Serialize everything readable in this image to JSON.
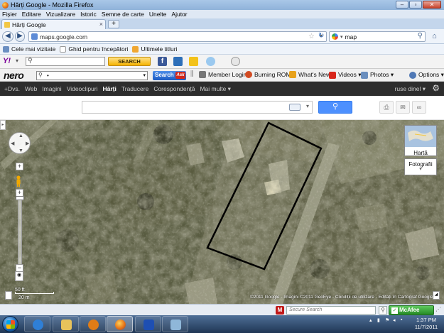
{
  "window": {
    "title": "Hărți Google - Mozilla Firefox"
  },
  "menu": [
    "Fișier",
    "Editare",
    "Vizualizare",
    "Istoric",
    "Semne de carte",
    "Unelte",
    "Ajutor"
  ],
  "tab": {
    "label": "Hărți Google",
    "close": "×",
    "new_tab": "+"
  },
  "nav": {
    "url": "maps.google.com",
    "search_value": "map",
    "search_engine": "google"
  },
  "bookmarks": [
    {
      "label": "Cele mai vizitate",
      "color": "#6b8fc2"
    },
    {
      "label": "Ghid pentru începători",
      "color": "#ffffff"
    },
    {
      "label": "Ultimele titluri",
      "color": "#f0a732"
    }
  ],
  "yahoo": {
    "logo": "Y!",
    "search_button": "SEARCH"
  },
  "nero": {
    "logo": "nero",
    "search_value": "•",
    "search_button": "Search",
    "ask_label": "Ask",
    "items": [
      {
        "label": "Member Login",
        "icon": "key-icon",
        "color": "#777777"
      },
      {
        "label": "Burning ROM",
        "icon": "disc-icon",
        "color": "#d24b22"
      },
      {
        "label": "What's New",
        "icon": "star-icon",
        "color": "#e8a21b"
      },
      {
        "label": "Videos ▾",
        "icon": "video-icon",
        "color": "#d8261b"
      },
      {
        "label": "Photos ▾",
        "icon": "photo-icon",
        "color": "#6a8ebd"
      },
      {
        "label": "Options ▾",
        "icon": "gear-icon",
        "color": "#4f78b5"
      }
    ]
  },
  "google_bar": {
    "items": [
      "+Dvs.",
      "Web",
      "Imagini",
      "Videoclipuri",
      "Hărți",
      "Traducere",
      "Corespondență",
      "Mai multe ▾"
    ],
    "active": "Hărți",
    "user": "ruse dinel ▾"
  },
  "maps": {
    "search_value": "",
    "map_type_map": "Hartă",
    "map_type_photo": "Fotografii",
    "scale_top": "50 ft",
    "scale_bottom": "20 m",
    "copyright": "©2011 Google - Imagini ©2011 GeoEye - Condiții de utilizare - Editați în Cartograf Google"
  },
  "status": {
    "secure_search_placeholder": "Secure Search",
    "mcafee_label": "McAfee"
  },
  "taskbar": {
    "apps": [
      {
        "name": "internet-explorer",
        "color": "#2f7fd6"
      },
      {
        "name": "explorer-folder",
        "color": "#e8c35b"
      },
      {
        "name": "media-player",
        "color": "#e07c17"
      },
      {
        "name": "firefox",
        "color": "#e36b12"
      },
      {
        "name": "picasa",
        "color": "#1e4fb3"
      },
      {
        "name": "paint",
        "color": "#8fb7d9"
      }
    ],
    "time": "1:37 PM",
    "date": "11/7/2011"
  }
}
